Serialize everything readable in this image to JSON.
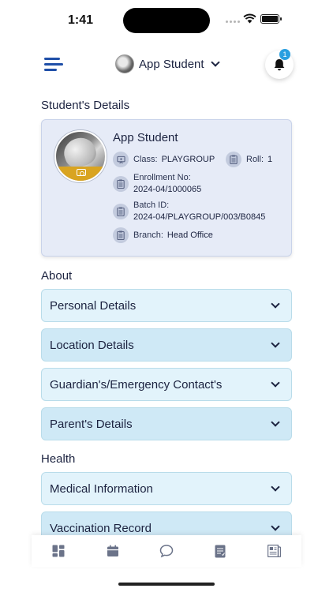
{
  "status_bar": {
    "time": "1:41"
  },
  "header": {
    "user_name": "App Student",
    "notification_count": "1"
  },
  "sections": {
    "student_details": "Student's Details",
    "about": "About",
    "health": "Health"
  },
  "student": {
    "name": "App Student",
    "class_label": "Class:",
    "class_value": "PLAYGROUP",
    "roll_label": "Roll:",
    "roll_value": "1",
    "enrollment_label": "Enrollment No:",
    "enrollment_value": "2024-04/1000065",
    "batch_label": "Batch ID:",
    "batch_value": "2024-04/PLAYGROUP/003/B0845",
    "branch_label": "Branch:",
    "branch_value": "Head Office"
  },
  "about_items": [
    {
      "label": "Personal Details"
    },
    {
      "label": "Location Details"
    },
    {
      "label": "Guardian's/Emergency Contact's"
    },
    {
      "label": "Parent's Details"
    }
  ],
  "health_items": [
    {
      "label": "Medical Information"
    },
    {
      "label": "Vaccination Record"
    }
  ],
  "bottom_nav": [
    "dashboard-icon",
    "calendar-icon",
    "chat-icon",
    "report-icon",
    "news-icon"
  ],
  "colors": {
    "accent": "#1f4fa8",
    "card_bg": "#e6ebf7",
    "accordion_light": "#e2f3fb",
    "accordion_dark": "#cfe9f6",
    "badge": "#2a9fe0",
    "camera_strip": "#d9a421"
  }
}
